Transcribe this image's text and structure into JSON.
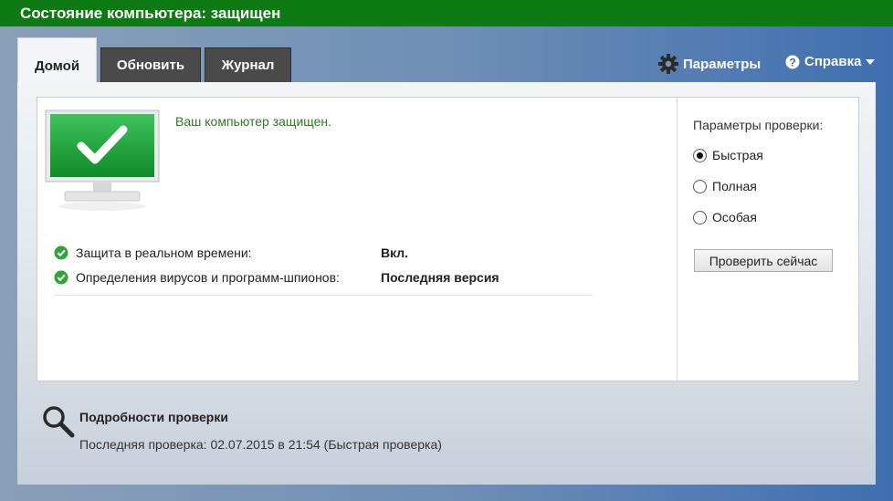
{
  "window": {
    "title": "Состояние компьютера: защищен"
  },
  "tabs": [
    {
      "label": "Домой",
      "active": true
    },
    {
      "label": "Обновить",
      "active": false
    },
    {
      "label": "Журнал",
      "active": false
    }
  ],
  "top_links": {
    "settings": "Параметры",
    "help": "Справка"
  },
  "status": {
    "message": "Ваш компьютер защищен.",
    "rows": [
      {
        "label": "Защита в реальном времени:",
        "value": "Вкл."
      },
      {
        "label": "Определения вирусов и программ-шпионов:",
        "value": "Последняя версия"
      }
    ]
  },
  "scan_options": {
    "title": "Параметры проверки:",
    "options": [
      {
        "label": "Быстрая",
        "selected": true
      },
      {
        "label": "Полная",
        "selected": false
      },
      {
        "label": "Особая",
        "selected": false
      }
    ],
    "button": "Проверить сейчас"
  },
  "scan_details": {
    "title": "Подробности проверки",
    "last_scan": "Последняя проверка: 02.07.2015 в 21:54 (Быстрая проверка)"
  },
  "colors": {
    "title_bar": "#0e7a14",
    "ok_green": "#2d7d1f",
    "monitor_screen": "#1aa23a"
  },
  "icons": [
    "gear-icon",
    "help-icon",
    "chevron-down-icon",
    "monitor-checkmark-icon",
    "check-circle-icon",
    "magnifier-icon"
  ]
}
